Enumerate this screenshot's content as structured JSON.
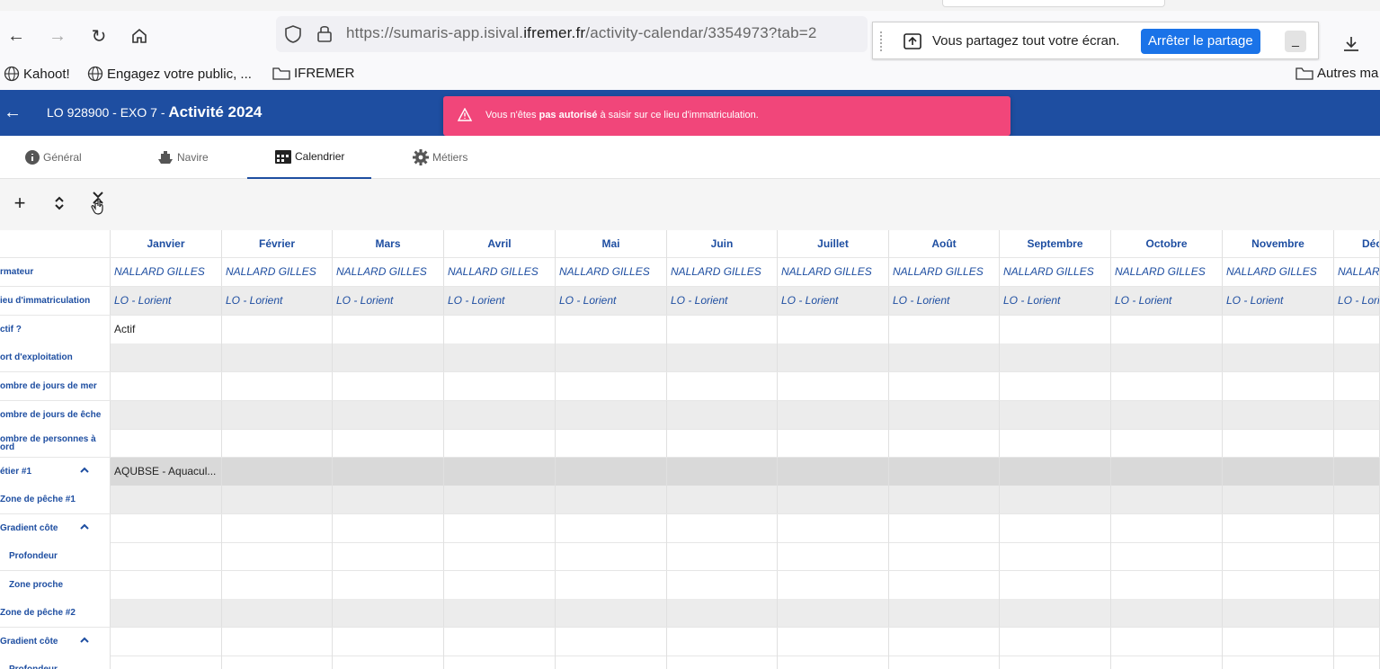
{
  "browser": {
    "url_prefix": "https://sumaris-app.isival.",
    "url_domain": "ifremer.fr",
    "url_suffix": "/activity-calendar/3354973?tab=2",
    "share_text": "Vous partagez tout votre écran.",
    "stop_share_label": "Arrêter le partage",
    "minimize_label": "_",
    "bookmarks": [
      {
        "label": "Kahoot!",
        "icon": "globe-icon"
      },
      {
        "label": "Engagez votre public, ...",
        "icon": "globe-icon"
      },
      {
        "label": "IFREMER",
        "icon": "folder-icon"
      }
    ],
    "other_bookmarks": "Autres ma"
  },
  "app": {
    "title_prefix": "LO 928900 - EXO 7 - ",
    "title_main": "Activité 2024",
    "toast": {
      "part1": "Vous n'êtes ",
      "bold": "pas autorisé",
      "part2": " à saisir sur ce lieu d'immatriculation."
    },
    "tabs": [
      {
        "label": "Général",
        "icon": "info-icon"
      },
      {
        "label": "Navire",
        "icon": "ship-icon"
      },
      {
        "label": "Calendrier",
        "icon": "calendar-icon",
        "active": true
      },
      {
        "label": "Métiers",
        "icon": "gear-icon"
      }
    ],
    "colors": {
      "primary": "#1e4ea1",
      "toast": "#f1467a",
      "share_button": "#1a73e8"
    }
  },
  "grid": {
    "months": [
      "Janvier",
      "Février",
      "Mars",
      "Avril",
      "Mai",
      "Juin",
      "Juillet",
      "Août",
      "Septembre",
      "Octobre",
      "Novembre",
      "Déc"
    ],
    "rows": [
      {
        "label": "rmateur",
        "values": [
          "NALLARD GILLES",
          "NALLARD GILLES",
          "NALLARD GILLES",
          "NALLARD GILLES",
          "NALLARD GILLES",
          "NALLARD GILLES",
          "NALLARD GILLES",
          "NALLARD GILLES",
          "NALLARD GILLES",
          "NALLARD GILLES",
          "NALLARD GILLES",
          "NALLAR"
        ]
      },
      {
        "label": "ieu d'immatriculation",
        "values": [
          "LO - Lorient",
          "LO - Lorient",
          "LO - Lorient",
          "LO - Lorient",
          "LO - Lorient",
          "LO - Lorient",
          "LO - Lorient",
          "LO - Lorient",
          "LO - Lorient",
          "LO - Lorient",
          "LO - Lorient",
          "LO - Lori"
        ]
      },
      {
        "label": "ctif ?",
        "values": [
          "Actif"
        ]
      },
      {
        "label": "ort d'exploitation",
        "values": []
      },
      {
        "label": "ombre de jours de mer",
        "values": []
      },
      {
        "label": "ombre de jours de êche",
        "values": []
      },
      {
        "label": "ombre de personnes à ord",
        "values": []
      },
      {
        "label": "étier #1",
        "values": [
          "AQUBSE - Aquacul..."
        ]
      },
      {
        "label": "Zone de pêche #1",
        "values": []
      },
      {
        "label": "Gradient côte",
        "values": []
      },
      {
        "label": "Profondeur",
        "values": []
      },
      {
        "label": "Zone proche",
        "values": []
      },
      {
        "label": "Zone de pêche #2",
        "values": []
      },
      {
        "label": "Gradient côte",
        "values": []
      },
      {
        "label": "Profondeur",
        "values": []
      }
    ]
  }
}
